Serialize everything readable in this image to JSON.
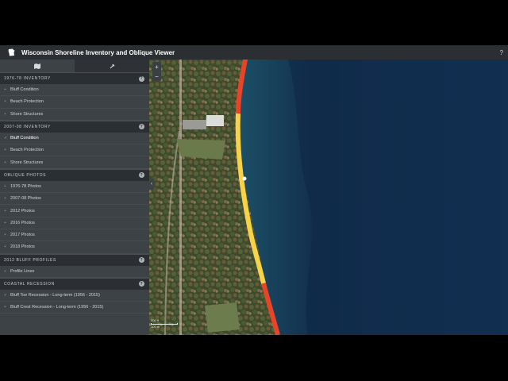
{
  "header": {
    "title": "Wisconsin Shoreline Inventory and Oblique Viewer",
    "help_symbol": "?"
  },
  "sidebar": {
    "tabs": [
      {
        "icon": "map-icon",
        "active": true
      },
      {
        "icon": "tools-icon",
        "active": false
      }
    ],
    "help_symbol": "?",
    "sections": [
      {
        "title": "1976-78 INVENTORY",
        "items": [
          {
            "label": "Bluff Condition",
            "active": false
          },
          {
            "label": "Beach Protection",
            "active": false
          },
          {
            "label": "Shore Structures",
            "active": false
          }
        ]
      },
      {
        "title": "2007-08 INVENTORY",
        "items": [
          {
            "label": "Bluff Condition",
            "active": true
          },
          {
            "label": "Beach Protection",
            "active": false
          },
          {
            "label": "Shore Structures",
            "active": false
          }
        ]
      },
      {
        "title": "OBLIQUE PHOTOS",
        "items": [
          {
            "label": "1976-78 Photos",
            "active": false
          },
          {
            "label": "2007-08 Photos",
            "active": false
          },
          {
            "label": "2012 Photos",
            "active": false
          },
          {
            "label": "2016 Photos",
            "active": false
          },
          {
            "label": "2017 Photos",
            "active": false
          },
          {
            "label": "2018 Photos",
            "active": false
          }
        ]
      },
      {
        "title": "2012 BLUFF PROFILES",
        "items": [
          {
            "label": "Profile Lines",
            "active": false
          }
        ]
      },
      {
        "title": "COASTAL RECESSION",
        "items": [
          {
            "label": "Bluff Toe Recession - Long-term (1956 - 2015)",
            "active": false
          },
          {
            "label": "Bluff Crest Recession - Long-term (1956 - 2015)",
            "active": false
          }
        ]
      }
    ]
  },
  "map": {
    "zoom_in": "+",
    "zoom_out": "−",
    "collapse_symbol": "‹",
    "scale": {
      "top": "200 ft",
      "bottom": "100 m"
    },
    "shoreline_colors": {
      "bluff_unstable": "#e8442a",
      "bluff_stable": "#f7d34a"
    },
    "water_colors": {
      "shallow": "#2f7e84",
      "deep": "#0f2b4d"
    }
  },
  "colors": {
    "header_bg": "#2b2f33",
    "panel_bg": "#3d4247",
    "active_check": "#8fd17a"
  }
}
